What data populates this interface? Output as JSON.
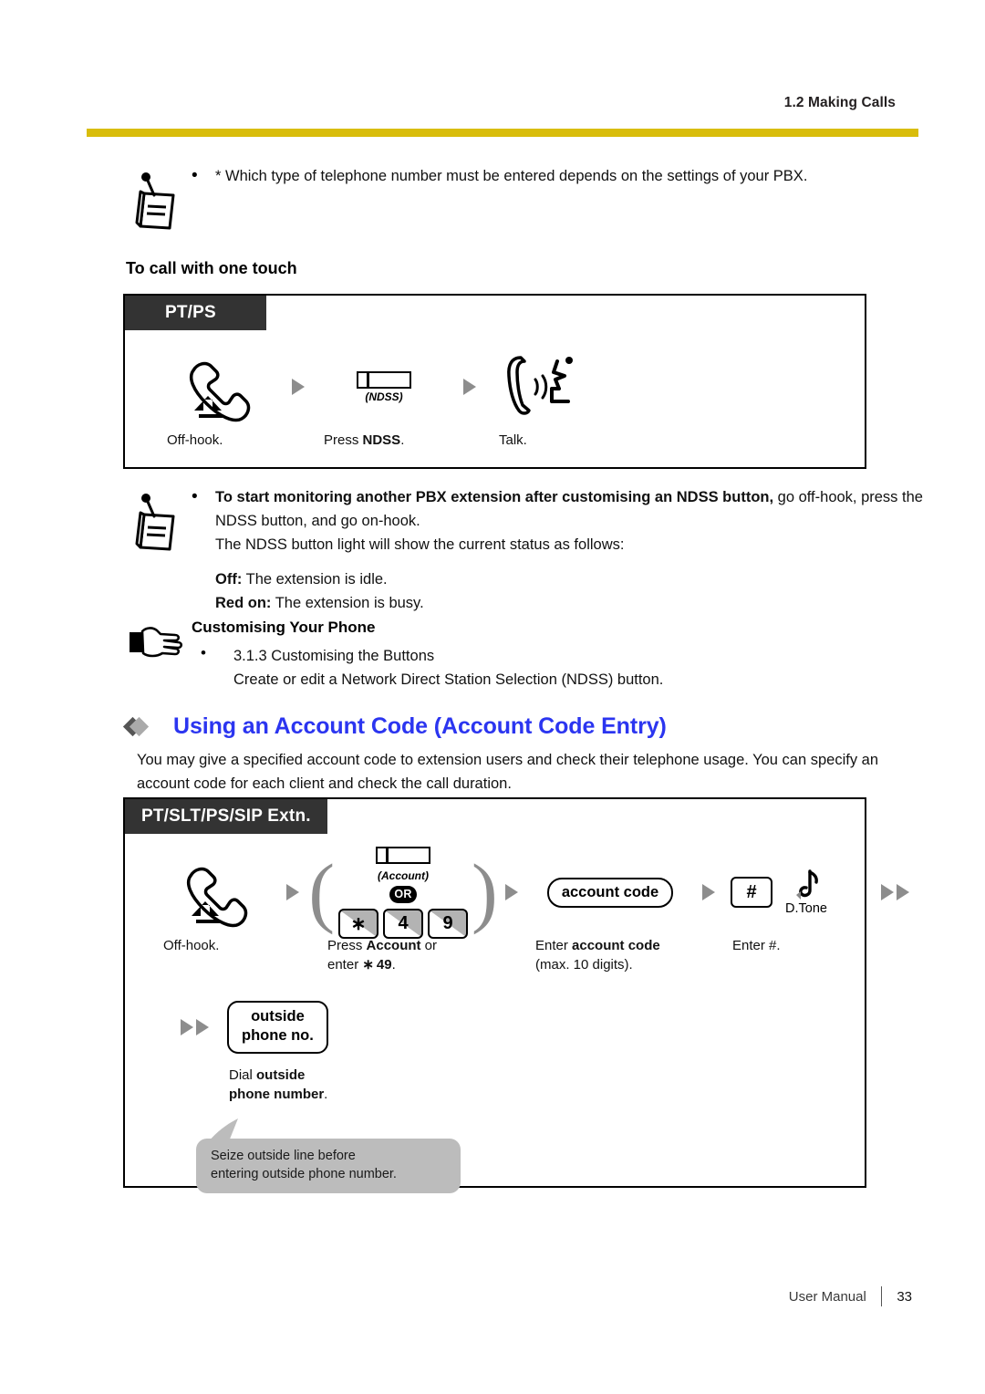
{
  "header": {
    "section_title": "1.2 Making Calls",
    "rule_color": "#d9bd0b"
  },
  "note_top": {
    "bullet": "•",
    "text": "* Which type of telephone number must be entered depends on the settings of your PBX.",
    "icon": "note-pencil-icon"
  },
  "sub_heading": "To call with one touch",
  "flow_ndss": {
    "tag": "PT/PS",
    "steps": [
      {
        "glyph": "handset-offhook-icon",
        "caption_plain": "Off-hook."
      },
      {
        "glyph": "lamp-button-icon",
        "lamp_label": "(NDSS)",
        "caption_pre": "Press ",
        "caption_bold": "NDSS",
        "caption_post": "."
      },
      {
        "glyph": "handset-talk-icon",
        "caption_plain": "Talk."
      }
    ]
  },
  "note_monitor": {
    "bullet": "•",
    "icon": "note-pencil-icon",
    "line1_bold": "To start monitoring another PBX extension after customising an NDSS button,",
    "line1_rest": " go off-hook, press the NDSS button, and go on-hook.",
    "line2": "The NDSS button light will show the current status as follows:",
    "status": [
      {
        "label": "Off:",
        "text": " The extension is idle."
      },
      {
        "label": "Red on:",
        "text": " The extension is busy."
      }
    ]
  },
  "customising": {
    "icon": "pointing-hand-icon",
    "title": "Customising Your Phone",
    "bullet": "•",
    "ref": "3.1.3 Customising the Buttons",
    "desc": "Create or edit a Network Direct Station Selection (NDSS) button."
  },
  "section": {
    "title": "Using an Account Code (Account Code Entry)",
    "title_color": "#2b35f0",
    "paragraph": "You may give a specified account code to extension users and check their telephone usage. You can specify an account code for each client and check the call duration."
  },
  "flow_account": {
    "tag": "PT/SLT/PS/SIP Extn.",
    "step1": {
      "glyph": "handset-offhook-icon",
      "caption": "Off-hook."
    },
    "step2": {
      "lamp_label": "(Account)",
      "or_badge": "OR",
      "keys": [
        "∗",
        "4",
        "9"
      ],
      "caption_line1_pre": "Press ",
      "caption_line1_bold": "Account",
      "caption_line1_post": " or",
      "caption_line2_pre": "enter ",
      "caption_line2_bold": "∗ 49",
      "caption_line2_post": "."
    },
    "step3": {
      "capsule": "account code",
      "caption_line1_pre": "Enter ",
      "caption_line1_bold": "account code",
      "caption_line2": "(max. 10 digits)."
    },
    "step4": {
      "keycap": "#",
      "tone_label": "D.Tone",
      "tone_icon": "musical-note-icon",
      "caption": "Enter #."
    },
    "step5": {
      "capsule_line1": "outside",
      "capsule_line2": "phone no.",
      "caption_line1_pre": "Dial ",
      "caption_line1_bold": "outside",
      "caption_line2_bold": "phone number",
      "caption_line2_post": "."
    },
    "bubble": {
      "line1": "Seize outside line before",
      "line2": "entering outside phone number.",
      "color": "#bcbcbc"
    }
  },
  "footer": {
    "label": "User Manual",
    "page": "33"
  }
}
